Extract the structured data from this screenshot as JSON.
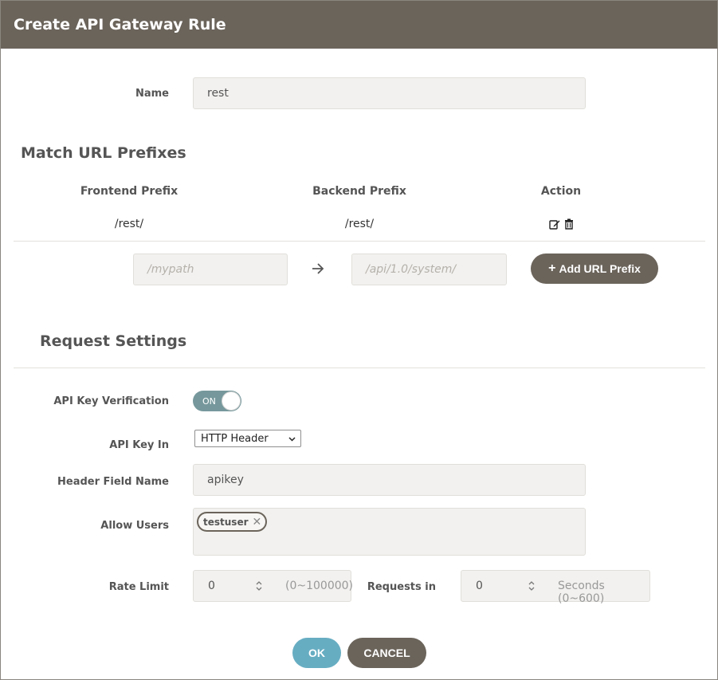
{
  "dialog": {
    "title": "Create API Gateway Rule"
  },
  "name_field": {
    "label": "Name",
    "value": "rest"
  },
  "match": {
    "section_title": "Match URL Prefixes",
    "columns": {
      "frontend": "Frontend Prefix",
      "backend": "Backend Prefix",
      "action": "Action"
    },
    "rows": [
      {
        "frontend": "/rest/",
        "backend": "/rest/"
      }
    ],
    "new_frontend_placeholder": "/mypath",
    "new_backend_placeholder": "/api/1.0/system/",
    "add_button_label": "Add URL Prefix",
    "icons": {
      "edit": "edit-icon",
      "delete": "trash-icon",
      "arrow": "arrow-right-icon",
      "add": "plus-icon"
    }
  },
  "request": {
    "section_title": "Request Settings",
    "api_key_verification": {
      "label": "API Key Verification",
      "state": "ON"
    },
    "api_key_in": {
      "label": "API Key In",
      "selected": "HTTP Header"
    },
    "header_field": {
      "label": "Header Field Name",
      "value": "apikey"
    },
    "allow_users": {
      "label": "Allow Users",
      "tags": [
        "testuser"
      ]
    },
    "rate_limit": {
      "label": "Rate Limit",
      "value": "0",
      "hint": "(0~100000)"
    },
    "requests_in": {
      "label": "Requests in",
      "value": "0",
      "hint": "Seconds (0~600)"
    }
  },
  "footer": {
    "ok_label": "OK",
    "cancel_label": "CANCEL"
  },
  "colors": {
    "titlebar": "#6b645b",
    "ok": "#67adc2",
    "toggle": "#76989c",
    "field_bg": "#f2f1ef"
  }
}
